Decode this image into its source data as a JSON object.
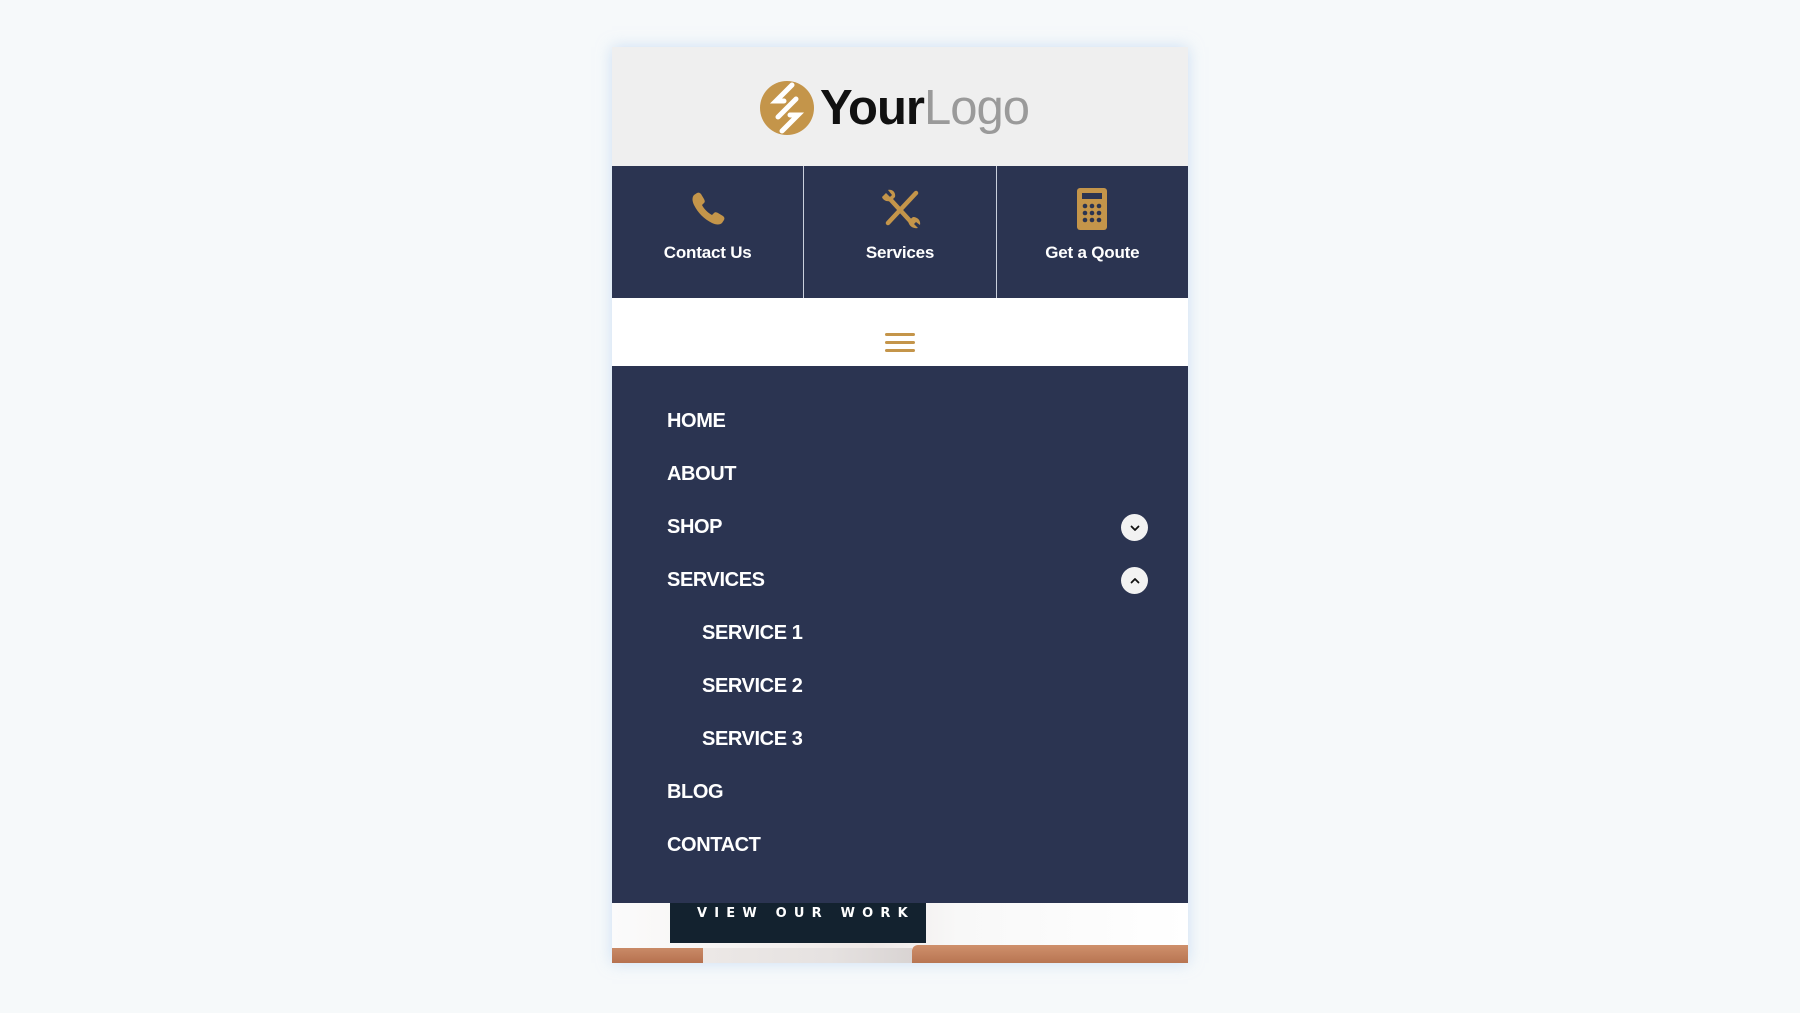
{
  "header": {
    "logo": {
      "icon": "logo-mark-icon",
      "strong": "Your",
      "light": "Logo"
    }
  },
  "quick_nav": [
    {
      "label": "Contact Us",
      "icon": "phone-icon"
    },
    {
      "label": "Services",
      "icon": "tools-icon"
    },
    {
      "label": "Get a Qoute",
      "icon": "calculator-icon"
    }
  ],
  "hamburger": {
    "icon": "hamburger-menu-icon"
  },
  "menu": {
    "items": [
      {
        "label": "HOME",
        "level": 0
      },
      {
        "label": "ABOUT",
        "level": 0
      },
      {
        "label": "SHOP",
        "level": 0,
        "toggle": "chevron-down-icon",
        "expanded": false
      },
      {
        "label": "SERVICES",
        "level": 0,
        "toggle": "chevron-up-icon",
        "expanded": true
      },
      {
        "label": "SERVICE 1",
        "level": 1
      },
      {
        "label": "SERVICE 2",
        "level": 1
      },
      {
        "label": "SERVICE 3",
        "level": 1
      },
      {
        "label": "BLOG",
        "level": 0
      },
      {
        "label": "CONTACT",
        "level": 0
      }
    ]
  },
  "hero": {
    "cta_label": "VIEW OUR WORK"
  },
  "colors": {
    "accent_gold": "#c4954a",
    "navy": "#2b3451",
    "cta_dark": "#13222f",
    "header_bg": "#efefef",
    "page_bg": "#f6f9fa"
  }
}
